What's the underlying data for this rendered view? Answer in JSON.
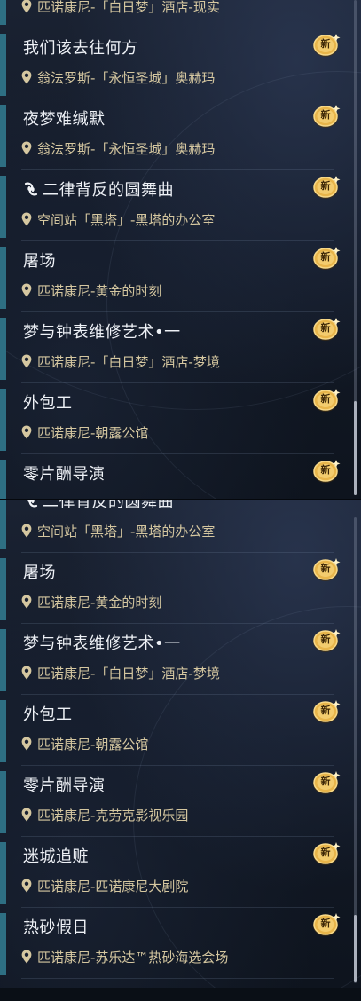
{
  "top_list": [
    {
      "title": "",
      "location": "匹诺康尼-「白日梦」酒店-现实",
      "badge": ""
    },
    {
      "title": "我们该去往何方",
      "location": "翁法罗斯-「永恒圣城」奥赫玛",
      "badge": "新"
    },
    {
      "title": "夜梦难缄默",
      "location": "翁法罗斯-「永恒圣城」奥赫玛",
      "badge": "新"
    },
    {
      "title": "二律背反的圆舞曲",
      "location": "空间站「黑塔」-黑塔的办公室",
      "badge": "新",
      "icon": "dream-icon"
    },
    {
      "title": "屠场",
      "location": "匹诺康尼-黄金的时刻",
      "badge": "新"
    },
    {
      "title": "梦与钟表维修艺术•一",
      "location": "匹诺康尼-「白日梦」酒店-梦境",
      "badge": "新"
    },
    {
      "title": "外包工",
      "location": "匹诺康尼-朝露公馆",
      "badge": "新"
    },
    {
      "title": "零片酬导演",
      "location": "",
      "badge": "新"
    }
  ],
  "bottom_list": [
    {
      "title": "二律背反的圆舞曲",
      "location": "空间站「黑塔」-黑塔的办公室",
      "badge": "",
      "icon": "dream-icon"
    },
    {
      "title": "屠场",
      "location": "匹诺康尼-黄金的时刻",
      "badge": "新"
    },
    {
      "title": "梦与钟表维修艺术•一",
      "location": "匹诺康尼-「白日梦」酒店-梦境",
      "badge": "新"
    },
    {
      "title": "外包工",
      "location": "匹诺康尼-朝露公馆",
      "badge": "新"
    },
    {
      "title": "零片酬导演",
      "location": "匹诺康尼-克劳克影视乐园",
      "badge": "新"
    },
    {
      "title": "迷城追赃",
      "location": "匹诺康尼-匹诺康尼大剧院",
      "badge": "新"
    },
    {
      "title": "热砂假日",
      "location": "匹诺康尼-苏乐达™热砂海选会场",
      "badge": "新"
    }
  ],
  "colors": {
    "accent_bar": "#2e6f83",
    "title_text": "#eef1f6",
    "location_text": "#d5c7a0",
    "badge_gold": "#e8b54a"
  },
  "icons": {
    "location": "map-pin-icon",
    "new": "new-badge-icon",
    "dream": "dream-icon"
  }
}
